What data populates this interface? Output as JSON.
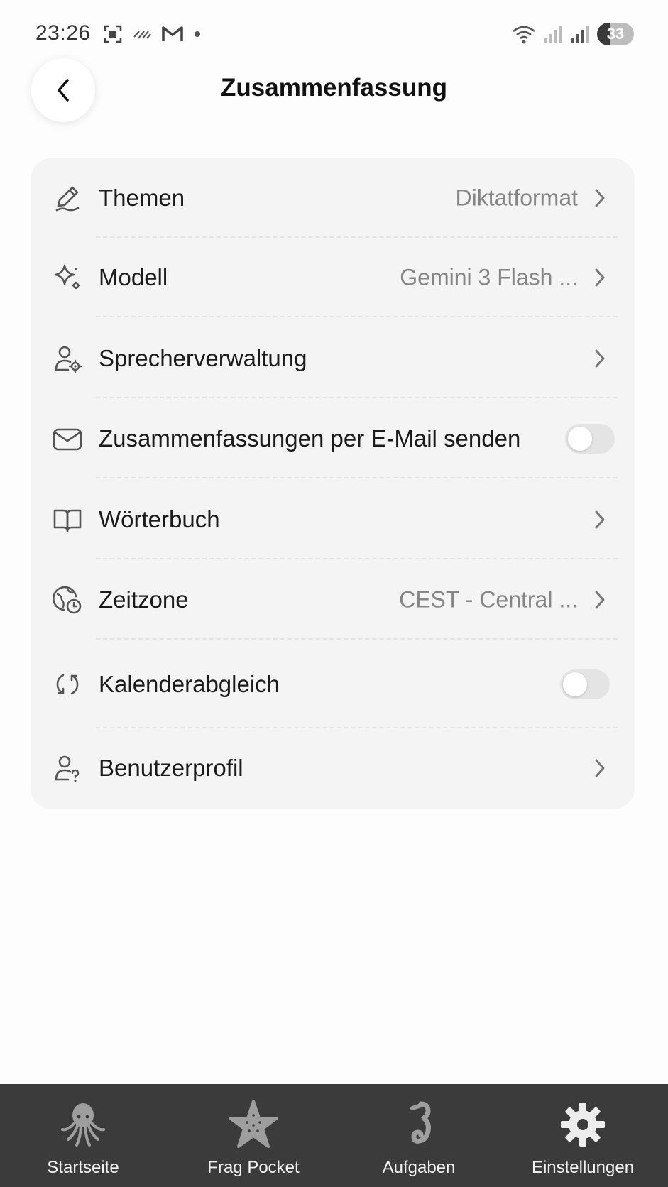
{
  "status_bar": {
    "time": "23:26",
    "battery": "33"
  },
  "header": {
    "title": "Zusammenfassung"
  },
  "settings": [
    {
      "label": "Themen",
      "value": "Diktatformat",
      "icon": "pencil-icon",
      "control": "chevron"
    },
    {
      "label": "Modell",
      "value": "Gemini 3 Flash ...",
      "icon": "sparkles-icon",
      "control": "chevron"
    },
    {
      "label": "Sprecherverwaltung",
      "value": "",
      "icon": "user-gear-icon",
      "control": "chevron"
    },
    {
      "label": "Zusammenfassungen per E-Mail senden",
      "value": "",
      "icon": "mail-icon",
      "control": "toggle",
      "enabled": false
    },
    {
      "label": "Wörterbuch",
      "value": "",
      "icon": "book-icon",
      "control": "chevron"
    },
    {
      "label": "Zeitzone",
      "value": "CEST - Central ...",
      "icon": "globe-clock-icon",
      "control": "chevron"
    },
    {
      "label": "Kalenderabgleich",
      "value": "",
      "icon": "sync-icon",
      "control": "toggle",
      "enabled": false
    },
    {
      "label": "Benutzerprofil",
      "value": "",
      "icon": "user-question-icon",
      "control": "chevron"
    }
  ],
  "bottom_nav": [
    {
      "label": "Startseite",
      "icon": "octopus-icon"
    },
    {
      "label": "Frag Pocket",
      "icon": "starfish-icon"
    },
    {
      "label": "Aufgaben",
      "icon": "seahorse-icon"
    },
    {
      "label": "Einstellungen",
      "icon": "gear-icon"
    }
  ],
  "colors": {
    "card_background": "#f4f4f4",
    "secondary_text": "#858585",
    "nav_background": "#3b3b3b"
  }
}
